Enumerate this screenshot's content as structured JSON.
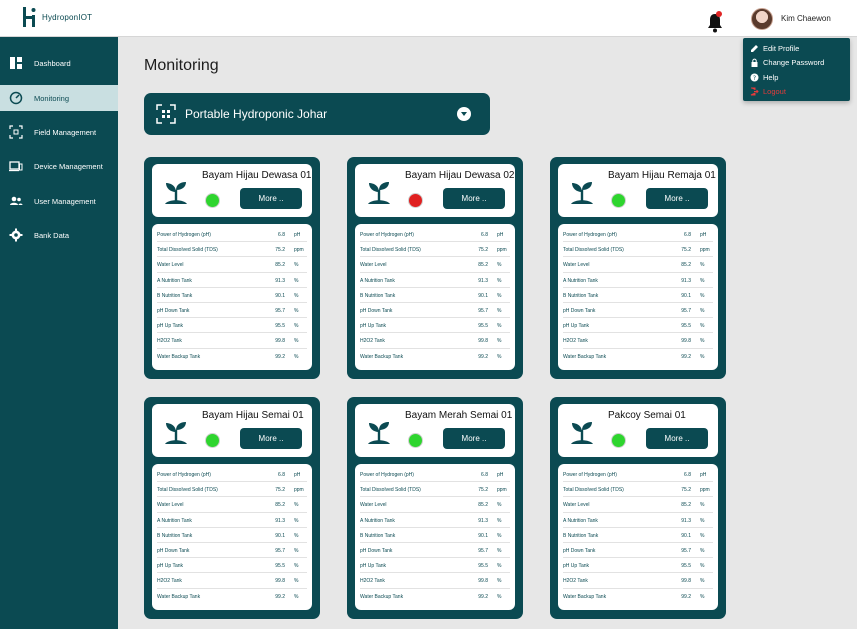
{
  "app": {
    "name": "HydroponIOT",
    "user": "Kim Chaewon"
  },
  "sidebar": {
    "items": [
      {
        "label": "Dashboard",
        "icon": "dashboard-icon"
      },
      {
        "label": "Monitoring",
        "icon": "gauge-icon"
      },
      {
        "label": "Field Management",
        "icon": "field-icon"
      },
      {
        "label": "Device Management",
        "icon": "devices-icon"
      },
      {
        "label": "User Management",
        "icon": "users-icon"
      },
      {
        "label": "Bank Data",
        "icon": "gear-icon"
      }
    ]
  },
  "user_menu": {
    "items": [
      {
        "label": "Edit Profile",
        "icon": "pencil-icon"
      },
      {
        "label": "Change Password",
        "icon": "lock-icon"
      },
      {
        "label": "Help",
        "icon": "help-icon"
      },
      {
        "label": "Logout",
        "icon": "logout-icon"
      }
    ]
  },
  "main": {
    "title": "Monitoring",
    "field_select": {
      "value": "Portable Hydroponic Johar"
    }
  },
  "more_label": "More ..",
  "metrics": [
    {
      "label": "Power of Hydrogen (pH)",
      "unit": "pH"
    },
    {
      "label": "Total Dissolved Solid (TDS)",
      "unit": "ppm"
    },
    {
      "label": "Water Level",
      "unit": "%"
    },
    {
      "label": "A Nutrition Tank",
      "unit": "%"
    },
    {
      "label": "B Nutrition Tank",
      "unit": "%"
    },
    {
      "label": "pH Down Tank",
      "unit": "%"
    },
    {
      "label": "pH Up Tank",
      "unit": "%"
    },
    {
      "label": "H2O2 Tank",
      "unit": "%"
    },
    {
      "label": "Water Backup Tank",
      "unit": "%"
    }
  ],
  "cards": [
    {
      "title": "Bayam Hijau Dewasa 01",
      "status": "online",
      "values": [
        "6.8",
        "75.2",
        "85.2",
        "91.3",
        "90.1",
        "95.7",
        "95.5",
        "99.8",
        "99.2"
      ]
    },
    {
      "title": "Bayam Hijau Dewasa 02",
      "status": "offline",
      "values": [
        "6.8",
        "75.2",
        "85.2",
        "91.3",
        "90.1",
        "95.7",
        "95.5",
        "99.8",
        "99.2"
      ]
    },
    {
      "title": "Bayam Hijau Remaja 01",
      "status": "online",
      "values": [
        "6.8",
        "75.2",
        "85.2",
        "91.3",
        "90.1",
        "95.7",
        "95.5",
        "99.8",
        "99.2"
      ]
    },
    {
      "title": "Bayam Hijau Semai 01",
      "status": "online",
      "values": [
        "6.8",
        "75.2",
        "85.2",
        "91.3",
        "90.1",
        "95.7",
        "95.5",
        "99.8",
        "99.2"
      ]
    },
    {
      "title": "Bayam Merah Semai 01",
      "status": "online",
      "values": [
        "6.8",
        "75.2",
        "85.2",
        "91.3",
        "90.1",
        "95.7",
        "95.5",
        "99.8",
        "99.2"
      ]
    },
    {
      "title": "Pakcoy Semai 01",
      "status": "online",
      "values": [
        "6.8",
        "75.2",
        "85.2",
        "91.3",
        "90.1",
        "95.7",
        "95.5",
        "99.8",
        "99.2"
      ]
    }
  ],
  "colors": {
    "primary": "#0b4a52",
    "online": "#2ed52e",
    "offline": "#e02020",
    "logout": "#e33b3b"
  }
}
